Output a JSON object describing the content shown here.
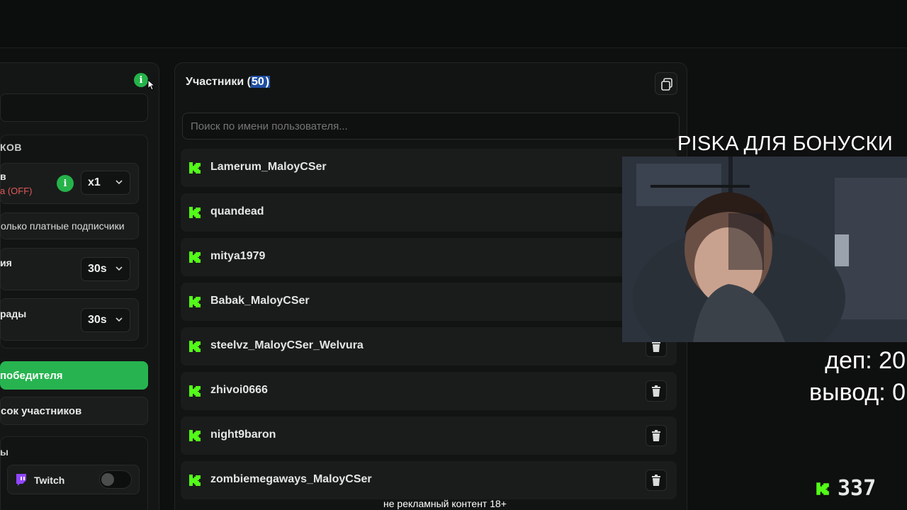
{
  "left_panel": {
    "section_title": "КОВ",
    "multiplier_label": "в",
    "multiplier_sub": "а (OFF)",
    "multiplier_value": "x1",
    "paid_only": "олько платные подписчики",
    "timer1_label": "ия",
    "timer1_value": "30s",
    "timer2_label": "рады",
    "timer2_value": "30s",
    "pick_winner": "победителя",
    "list_button": "сок участников",
    "platforms_title": "ы",
    "twitch_label": "Twitch"
  },
  "participants": {
    "title": "Участники",
    "count_open": " (",
    "count": "50",
    "count_close": ")",
    "search_placeholder": "Поиск по имени пользователя...",
    "items": [
      {
        "name": "Lamerum_MaloyCSer"
      },
      {
        "name": "quandead"
      },
      {
        "name": "mitya1979"
      },
      {
        "name": "Babak_MaloyCSer"
      },
      {
        "name": "steelvz_MaloyCSer_Welvura"
      },
      {
        "name": "zhivoi0666"
      },
      {
        "name": "night9baron"
      },
      {
        "name": "zombiemegaways_MaloyCSer"
      }
    ]
  },
  "overlay": {
    "title": "PISKA ДЛЯ БОНУСКИ",
    "dep": "деп: 20",
    "withdraw": "вывод: 0",
    "score": "337",
    "footer": "не рекламный контент 18+"
  },
  "colors": {
    "accent_green": "#27b450",
    "kick_green": "#53fc18"
  }
}
